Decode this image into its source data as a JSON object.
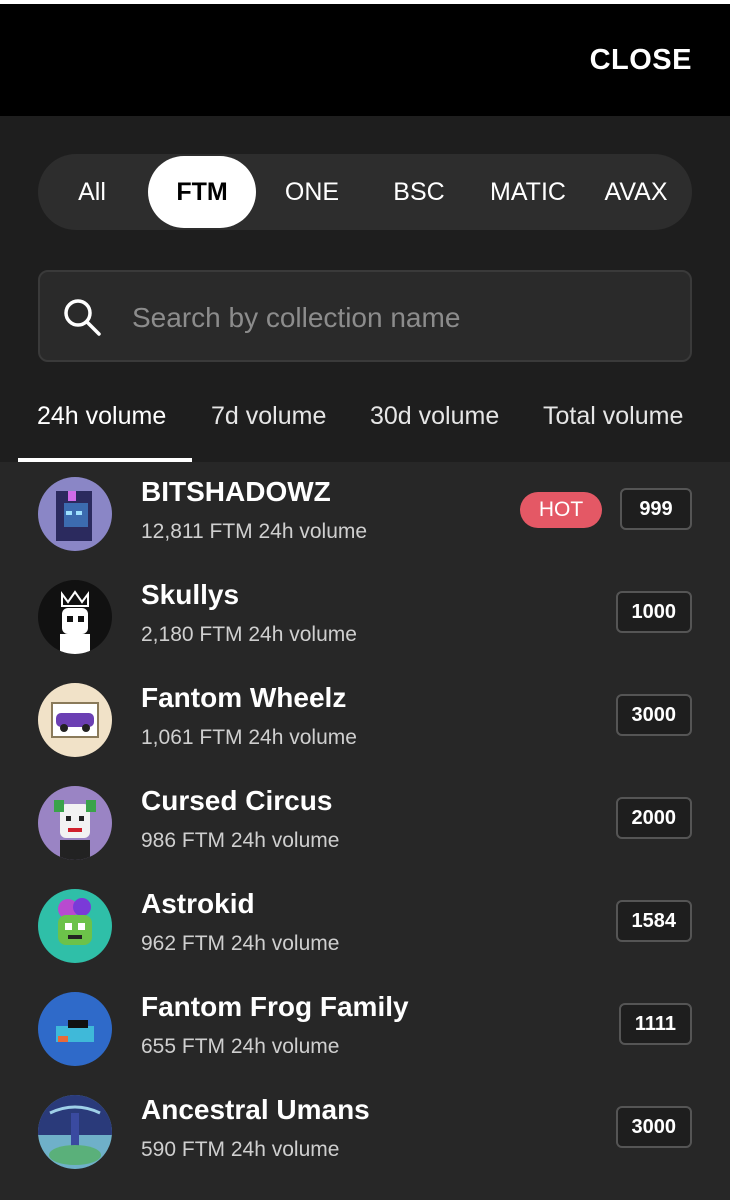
{
  "header": {
    "close_label": "CLOSE"
  },
  "chains": {
    "items": [
      "All",
      "FTM",
      "ONE",
      "BSC",
      "MATIC",
      "AVAX"
    ],
    "selected": "FTM"
  },
  "search": {
    "placeholder": "Search by collection name",
    "value": ""
  },
  "volume_tabs": {
    "items": [
      "24h volume",
      "7d volume",
      "30d volume",
      "Total volume"
    ],
    "selected": "24h volume"
  },
  "collections": [
    {
      "name": "BITSHADOWZ",
      "volume": "12,811 FTM 24h volume",
      "badge": "HOT",
      "count": "999",
      "avatar": "bitshadowz-avatar",
      "color": "#8a86c6"
    },
    {
      "name": "Skullys",
      "volume": "2,180 FTM 24h volume",
      "badge": "",
      "count": "1000",
      "avatar": "skullys-avatar",
      "color": "#111111"
    },
    {
      "name": "Fantom Wheelz",
      "volume": "1,061 FTM 24h volume",
      "badge": "",
      "count": "3000",
      "avatar": "fantom-wheelz-avatar",
      "color": "#f1e2c8"
    },
    {
      "name": "Cursed Circus",
      "volume": "986 FTM 24h volume",
      "badge": "",
      "count": "2000",
      "avatar": "cursed-circus-avatar",
      "color": "#9a84c4"
    },
    {
      "name": "Astrokid",
      "volume": "962 FTM 24h volume",
      "badge": "",
      "count": "1584",
      "avatar": "astrokid-avatar",
      "color": "#2fbfa8"
    },
    {
      "name": "Fantom Frog Family",
      "volume": "655 FTM 24h volume",
      "badge": "",
      "count": "1111",
      "avatar": "fantom-frog-family-avatar",
      "color": "#2f6ac9"
    },
    {
      "name": "Ancestral Umans",
      "volume": "590 FTM 24h volume",
      "badge": "",
      "count": "3000",
      "avatar": "ancestral-umans-avatar",
      "color": "#6fb0c9"
    }
  ]
}
